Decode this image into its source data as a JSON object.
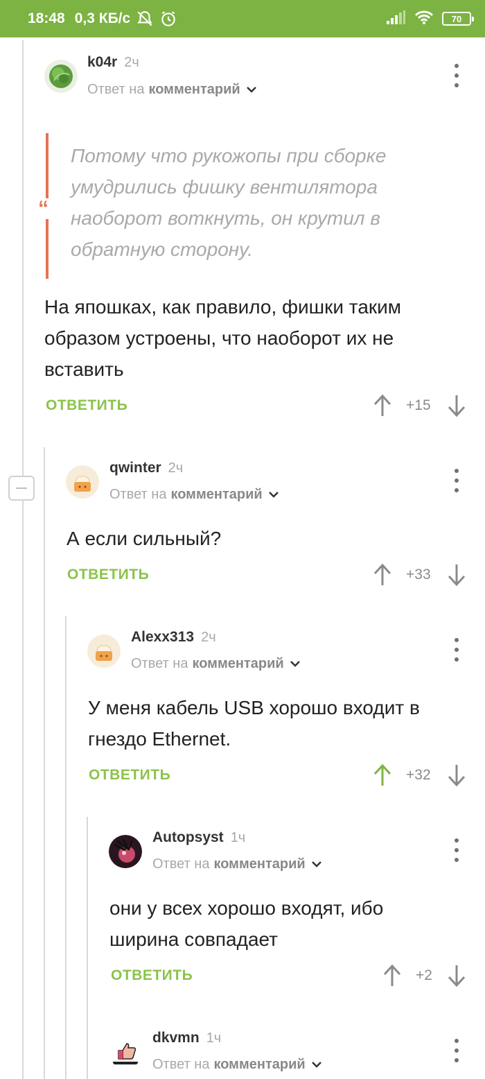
{
  "status_bar": {
    "time": "18:48",
    "speed": "0,3 КБ/с",
    "battery": "70"
  },
  "common": {
    "reply_to": "Ответ на",
    "comment_word": "комментарий",
    "reply_button": "ОТВЕТИТЬ"
  },
  "comments": [
    {
      "user": "k04r",
      "ago": "2ч",
      "quote": "Потому что рукожопы при сборке умудрились фишку вентилятора наоборот воткнуть, он крутил в обратную сторону.",
      "text": "На япошках, как правило, фишки таким образом устроены, что наоборот их не вставить",
      "score": "+15"
    },
    {
      "user": "qwinter",
      "ago": "2ч",
      "text": "А если сильный?",
      "score": "+33"
    },
    {
      "user": "Alexx313",
      "ago": "2ч",
      "text": "У меня кабель USB хорошо входит в гнездо Ethernet.",
      "score": "+32",
      "upvoted": true
    },
    {
      "user": "Autopsyst",
      "ago": "1ч",
      "text": "они у всех хорошо входят, ибо ширина совпадает",
      "score": "+2"
    },
    {
      "user": "dkvmn",
      "ago": "1ч"
    }
  ],
  "colors": {
    "accent": "#7cb342",
    "reply": "#8bc34a",
    "quote": "#e57356"
  }
}
